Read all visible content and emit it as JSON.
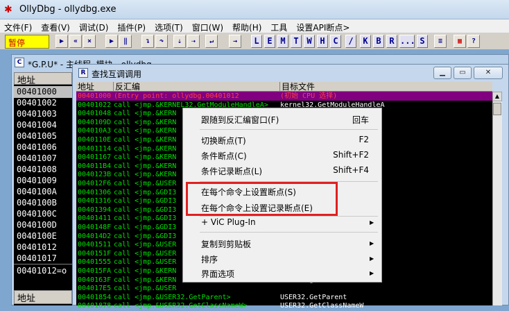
{
  "window": {
    "title": "OllyDbg - ollydbg.exe"
  },
  "menubar": [
    "文件(F)",
    "查看(V)",
    "调试(D)",
    "插件(P)",
    "选项(T)",
    "窗口(W)",
    "帮助(H)",
    "工具",
    "设置API断点>"
  ],
  "toolbar": {
    "status": "暂停",
    "letters": [
      "L",
      "E",
      "M",
      "T",
      "W",
      "H",
      "C",
      "/",
      "K",
      "B",
      "R",
      "...",
      "S"
    ]
  },
  "cpu_window": {
    "title": "*G.P.U* - 主线程, 模块 - ollydbg",
    "addr_header": "地址",
    "addresses": [
      "00401000",
      "00401002",
      "00401003",
      "00401004",
      "00401005",
      "00401006",
      "00401007",
      "00401008",
      "00401009",
      "0040100A",
      "0040100B",
      "0040100C",
      "0040100D",
      "0040100E",
      "00401012",
      "00401017"
    ],
    "footer": "00401012=o",
    "addr_header_bottom": "地址"
  },
  "dialog": {
    "title": "查找互调调用",
    "columns": [
      "地址",
      "反汇编",
      "目标文件"
    ],
    "rows": [
      {
        "addr": "00401000",
        "disasm": "(Entry point: ollydbg.00401012",
        "target": "(初始 CPU 选择)",
        "highlight": true
      },
      {
        "addr": "00401022",
        "disasm": "call <jmp.&KERNEL32.GetModuleHandleA>",
        "target": "kernel32.GetModuleHandleA"
      },
      {
        "addr": "00401048",
        "disasm": "call <jmp.&KERN",
        "target": "A"
      },
      {
        "addr": "0040109D",
        "disasm": "call <jmp.&KERN",
        "target": ""
      },
      {
        "addr": "004010A3",
        "disasm": "call <jmp.&KERN",
        "target": ""
      },
      {
        "addr": "0040110E",
        "disasm": "call <jmp.&KERN",
        "target": ""
      },
      {
        "addr": "00401114",
        "disasm": "call <jmp.&KERN",
        "target": ""
      },
      {
        "addr": "00401167",
        "disasm": "call <jmp.&KERN",
        "target": "eA"
      },
      {
        "addr": "004011B4",
        "disasm": "call <jmp.&KERN",
        "target": ""
      },
      {
        "addr": "0040123B",
        "disasm": "call <jmp.&KERN",
        "target": ""
      },
      {
        "addr": "004012F6",
        "disasm": "call <jmp.&USER",
        "target": ""
      },
      {
        "addr": "00401306",
        "disasm": "call <jmp.&GDI3",
        "target": ""
      },
      {
        "addr": "00401316",
        "disasm": "call <jmp.&GDI3",
        "target": ""
      },
      {
        "addr": "00401394",
        "disasm": "call <jmp.&GDI3",
        "target": ""
      },
      {
        "addr": "00401411",
        "disasm": "call <jmp.&GDI3",
        "target": "W"
      },
      {
        "addr": "0040148F",
        "disasm": "call <jmp.&GDI3",
        "target": "2W"
      },
      {
        "addr": "004014D2",
        "disasm": "call <jmp.&GDI3",
        "target": "2W"
      },
      {
        "addr": "00401511",
        "disasm": "call <jmp.&USER",
        "target": ""
      },
      {
        "addr": "0040151F",
        "disasm": "call <jmp.&USER",
        "target": ""
      },
      {
        "addr": "00401555",
        "disasm": "call <jmp.&USER",
        "target": ""
      },
      {
        "addr": "004015FA",
        "disasm": "call <jmp.&KERN",
        "target": "fileStringW"
      },
      {
        "addr": "0040163F",
        "disasm": "call <jmp.&KERN",
        "target": "leStringW"
      },
      {
        "addr": "004017E5",
        "disasm": "call <jmp.&USER",
        "target": ""
      },
      {
        "addr": "00401854",
        "disasm": "call <jmp.&USER32.GetParent>",
        "target": "USER32.GetParent"
      },
      {
        "addr": "00401878",
        "disasm": "call <jmp.&USER32.GetClassNameW>",
        "target": "USER32.GetClassNameW"
      }
    ]
  },
  "context_menu": {
    "items": [
      {
        "label": "跟随到反汇编窗口(F)",
        "shortcut": "回车"
      },
      {
        "label": "切换断点(T)",
        "shortcut": "F2"
      },
      {
        "label": "条件断点(C)",
        "shortcut": "Shift+F2"
      },
      {
        "label": "条件记录断点(L)",
        "shortcut": "Shift+F4"
      },
      {
        "label": "在每个命令上设置断点(S)",
        "shortcut": ""
      },
      {
        "label": "在每个命令上设置记录断点(E)",
        "shortcut": ""
      },
      {
        "label": "+ ViC Plug-In",
        "shortcut": ""
      },
      {
        "label": "复制到剪贴板",
        "shortcut": ""
      },
      {
        "label": "排序",
        "shortcut": ""
      },
      {
        "label": "界面选项",
        "shortcut": ""
      }
    ]
  },
  "colors": {
    "highlight_box": "#e02020",
    "row_text": "#00e000",
    "selected_row": "#800080"
  }
}
